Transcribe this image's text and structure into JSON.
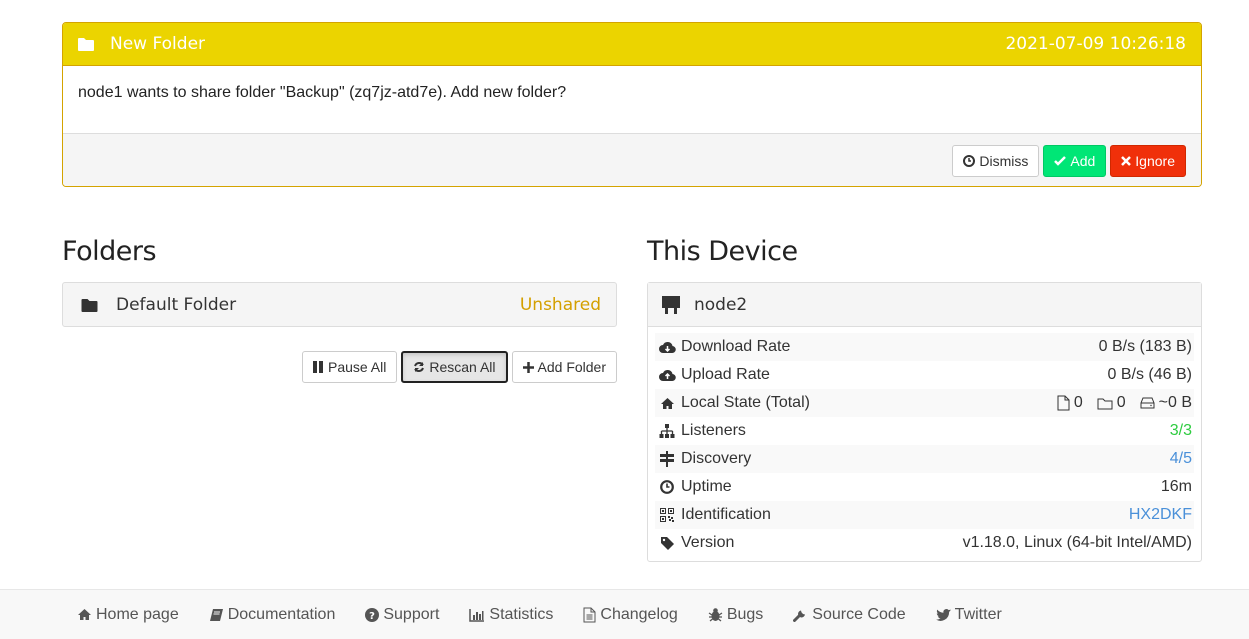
{
  "notice": {
    "title": "New Folder",
    "timestamp": "2021-07-09 10:26:18",
    "message": "node1 wants to share folder \"Backup\" (zq7jz-atd7e). Add new folder?",
    "buttons": {
      "dismiss": "Dismiss",
      "add": "Add",
      "ignore": "Ignore"
    }
  },
  "folders": {
    "heading": "Folders",
    "items": [
      {
        "name": "Default Folder",
        "status": "Unshared"
      }
    ],
    "buttons": {
      "pause_all": "Pause All",
      "rescan_all": "Rescan All",
      "add_folder": "Add Folder"
    }
  },
  "device": {
    "heading": "This Device",
    "name": "node2",
    "rows": {
      "download_rate": {
        "label": "Download Rate",
        "value": "0 B/s (183 B)"
      },
      "upload_rate": {
        "label": "Upload Rate",
        "value": "0 B/s (46 B)"
      },
      "local_state": {
        "label": "Local State (Total)",
        "files": "0",
        "dirs": "0",
        "size": "~0 B"
      },
      "listeners": {
        "label": "Listeners",
        "value": "3/3"
      },
      "discovery": {
        "label": "Discovery",
        "value": "4/5"
      },
      "uptime": {
        "label": "Uptime",
        "value": "16m"
      },
      "identification": {
        "label": "Identification",
        "value": "HX2DKF"
      },
      "version": {
        "label": "Version",
        "value": "v1.18.0, Linux (64-bit Intel/AMD)"
      }
    }
  },
  "footer": {
    "links": {
      "home": "Home page",
      "docs": "Documentation",
      "support": "Support",
      "stats": "Statistics",
      "changelog": "Changelog",
      "bugs": "Bugs",
      "source": "Source Code",
      "twitter": "Twitter"
    }
  },
  "colors": {
    "notice_header": "#ebd400",
    "add_button": "#00e676",
    "ignore_button": "#f0300a",
    "unshared": "#d4a000",
    "listeners_ok": "#2ecc40",
    "link_blue": "#4a90d9"
  }
}
